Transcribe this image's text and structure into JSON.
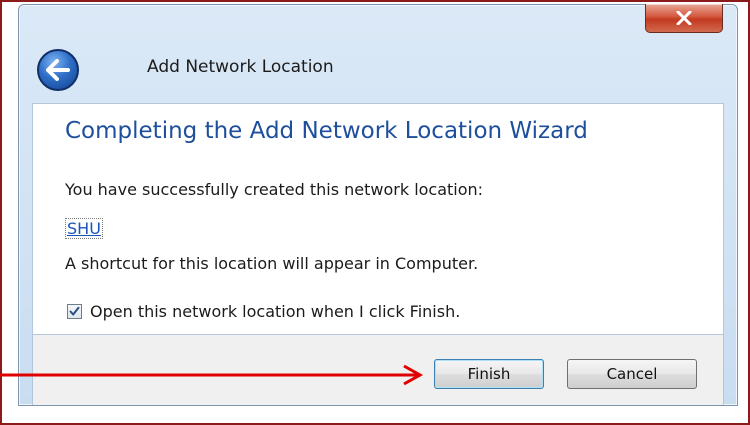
{
  "window": {
    "title": "Add Network Location",
    "close_label": "X"
  },
  "wizard": {
    "heading": "Completing the Add Network Location Wizard",
    "success_text": "You have successfully created this network location:",
    "location_name": "SHU",
    "shortcut_text": "A shortcut for this location will appear in Computer.",
    "open_checkbox": {
      "label": "Open this network location when I click Finish.",
      "checked": true
    }
  },
  "buttons": {
    "finish_label": "Finish",
    "cancel_label": "Cancel"
  },
  "icons": {
    "back": "back-arrow-icon",
    "close": "close-icon",
    "check": "checkmark-icon"
  },
  "colors": {
    "heading": "#1e4f9c",
    "link": "#1a55b8",
    "annotation_arrow": "#e00000",
    "frame_outline": "#8b1a1a"
  }
}
